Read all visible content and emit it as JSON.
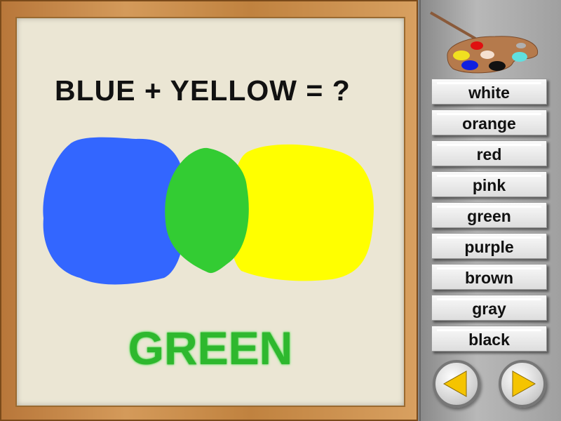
{
  "question": "BLUE + YELLOW = ?",
  "answer": "GREEN",
  "colors": {
    "blue": "#3366ff",
    "yellow": "#ffff00",
    "green": "#33cc33",
    "answer": "#2eb82e",
    "arrow": "#f5c400"
  },
  "choices": [
    "white",
    "orange",
    "red",
    "pink",
    "green",
    "purple",
    "brown",
    "gray",
    "black"
  ],
  "nav": {
    "prev_icon": "arrow-left-icon",
    "next_icon": "arrow-right-icon"
  },
  "decor": {
    "palette_icon": "paint-palette-icon"
  }
}
